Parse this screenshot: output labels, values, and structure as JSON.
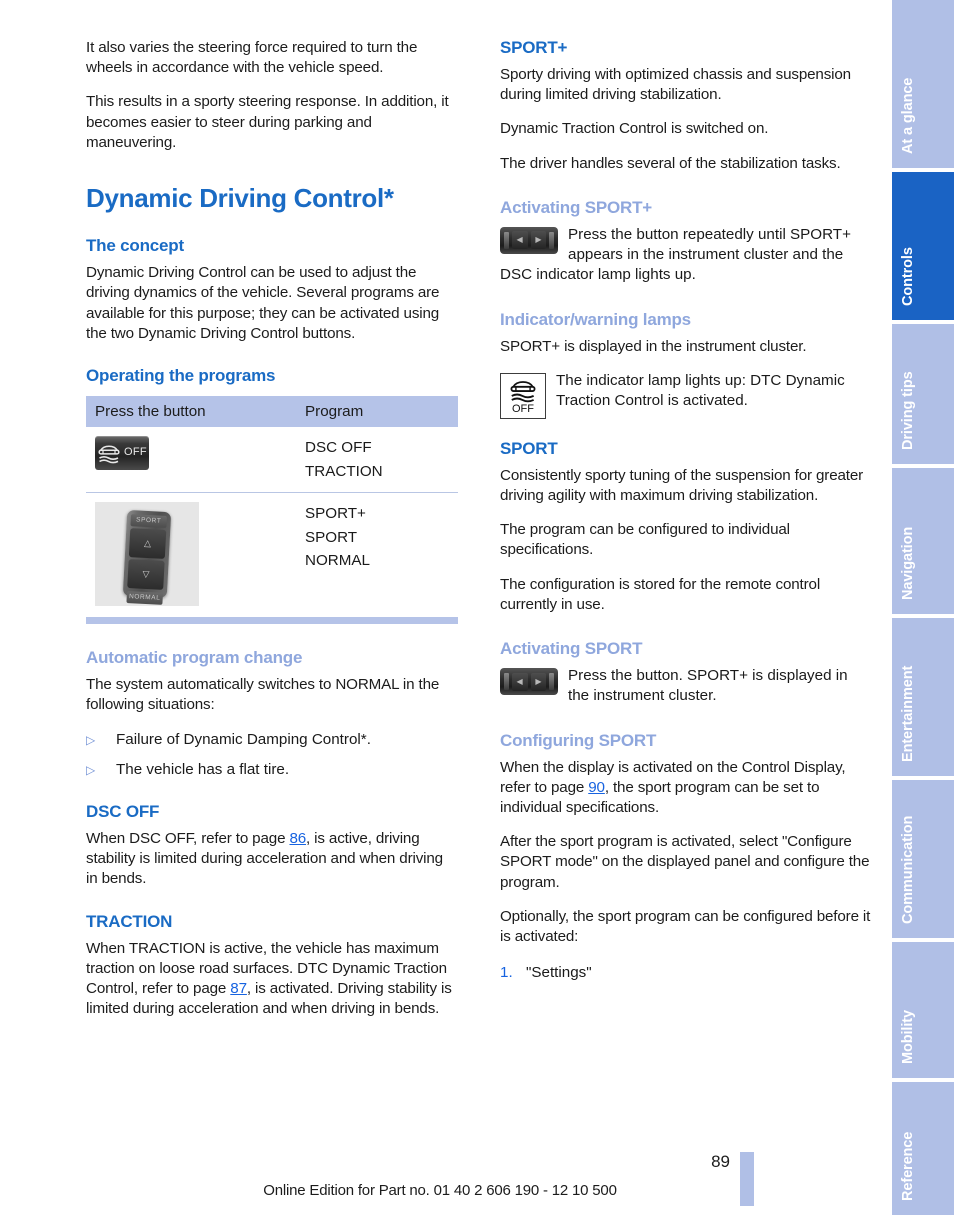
{
  "document": {
    "page_number": "89",
    "footer": "Online Edition for Part no. 01 40 2 606 190 - 12 10 500"
  },
  "colors": {
    "heading_blue": "#1a6bc4",
    "subheading_blue": "#8fa7dd",
    "link_blue": "#1763e0",
    "tab_inactive": "#b0bfe6",
    "tab_active": "#1a63c4",
    "table_header": "#b5c3e8"
  },
  "left_column": {
    "intro_para_1": "It also varies the steering force required to turn the wheels in accordance with the vehicle speed.",
    "intro_para_2": "This results in a sporty steering response. In addition, it becomes easier to steer during parking and maneuvering.",
    "title": "Dynamic Driving Control*",
    "concept_heading": "The concept",
    "concept_para": "Dynamic Driving Control can be used to adjust the driving dynamics of the vehicle. Several programs are available for this purpose; they can be activated using the two Dynamic Driving Control buttons.",
    "operating_heading": "Operating the programs",
    "table": {
      "headers": [
        "Press the button",
        "Program"
      ],
      "rows": [
        {
          "button_icon": "dsc-off-button",
          "programs": [
            "DSC OFF",
            "TRACTION"
          ]
        },
        {
          "button_icon": "sport-normal-rocker-switch",
          "programs": [
            "SPORT+",
            "SPORT",
            "NORMAL"
          ]
        }
      ]
    },
    "auto_change_heading": "Automatic program change",
    "auto_change_para": "The system automatically switches to NORMAL in the following situations:",
    "auto_change_bullets": [
      "Failure of Dynamic Damping Control*.",
      "The vehicle has a flat tire."
    ],
    "dsc_off_heading": "DSC OFF",
    "dsc_off_para_before": "When DSC OFF, refer to page ",
    "dsc_off_page_link": "86",
    "dsc_off_para_after": ", is active, driving stability is limited during acceleration and when driving in bends.",
    "traction_heading": "TRACTION",
    "traction_para_before": "When TRACTION is active, the vehicle has maximum traction on loose road surfaces. DTC Dynamic Traction Control, refer to page ",
    "traction_page_link": "87",
    "traction_para_after": ", is activated. Driving stability is limited during acceleration and when driving in bends."
  },
  "right_column": {
    "sport_plus_heading": "SPORT+",
    "sport_plus_para_1": "Sporty driving with optimized chassis and suspension during limited driving stabilization.",
    "sport_plus_para_2": "Dynamic Traction Control is switched on.",
    "sport_plus_para_3": "The driver handles several of the stabilization tasks.",
    "activating_sport_plus_heading": "Activating SPORT+",
    "activating_sport_plus_text": "Press the button repeatedly until SPORT+ appears in the instrument cluster and the DSC indicator lamp lights up.",
    "indicator_lamps_heading": "Indicator/warning lamps",
    "indicator_lamps_para": "SPORT+ is displayed in the instrument cluster.",
    "indicator_lamp_text": "The indicator lamp lights up: DTC Dynamic Traction Control is activated.",
    "sport_heading": "SPORT",
    "sport_para_1": "Consistently sporty tuning of the suspension for greater driving agility with maximum driving stabilization.",
    "sport_para_2": "The program can be configured to individual specifications.",
    "sport_para_3": "The configuration is stored for the remote control currently in use.",
    "activating_sport_heading": "Activating SPORT",
    "activating_sport_text": "Press the button. SPORT+ is displayed in the instrument cluster.",
    "configuring_sport_heading": "Configuring SPORT",
    "configuring_para_1_before": "When the display is activated on the Control Display, refer to page ",
    "configuring_page_link": "90",
    "configuring_para_1_after": ", the sport program can be set to individual specifications.",
    "configuring_para_2": "After the sport program is activated, select \"Configure SPORT mode\" on the displayed panel and configure the program.",
    "configuring_para_3": "Optionally, the sport program can be configured before it is activated:",
    "step_number": "1.",
    "step_text": "\"Settings\""
  },
  "sidebar": {
    "tabs": [
      {
        "label": "At a glance",
        "active": false
      },
      {
        "label": "Controls",
        "active": true
      },
      {
        "label": "Driving tips",
        "active": false
      },
      {
        "label": "Navigation",
        "active": false
      },
      {
        "label": "Entertainment",
        "active": false
      },
      {
        "label": "Communication",
        "active": false
      },
      {
        "label": "Mobility",
        "active": false
      },
      {
        "label": "Reference",
        "active": false
      }
    ]
  },
  "icons": {
    "dsc_off_label": "OFF",
    "lamp_off_label": "OFF",
    "rocker_top_label": "SPORT",
    "rocker_bottom_label": "NORMAL",
    "rocker_up_glyph": "△",
    "rocker_down_glyph": "▽",
    "mini_left_glyph": "◀",
    "mini_right_glyph": "▶"
  }
}
